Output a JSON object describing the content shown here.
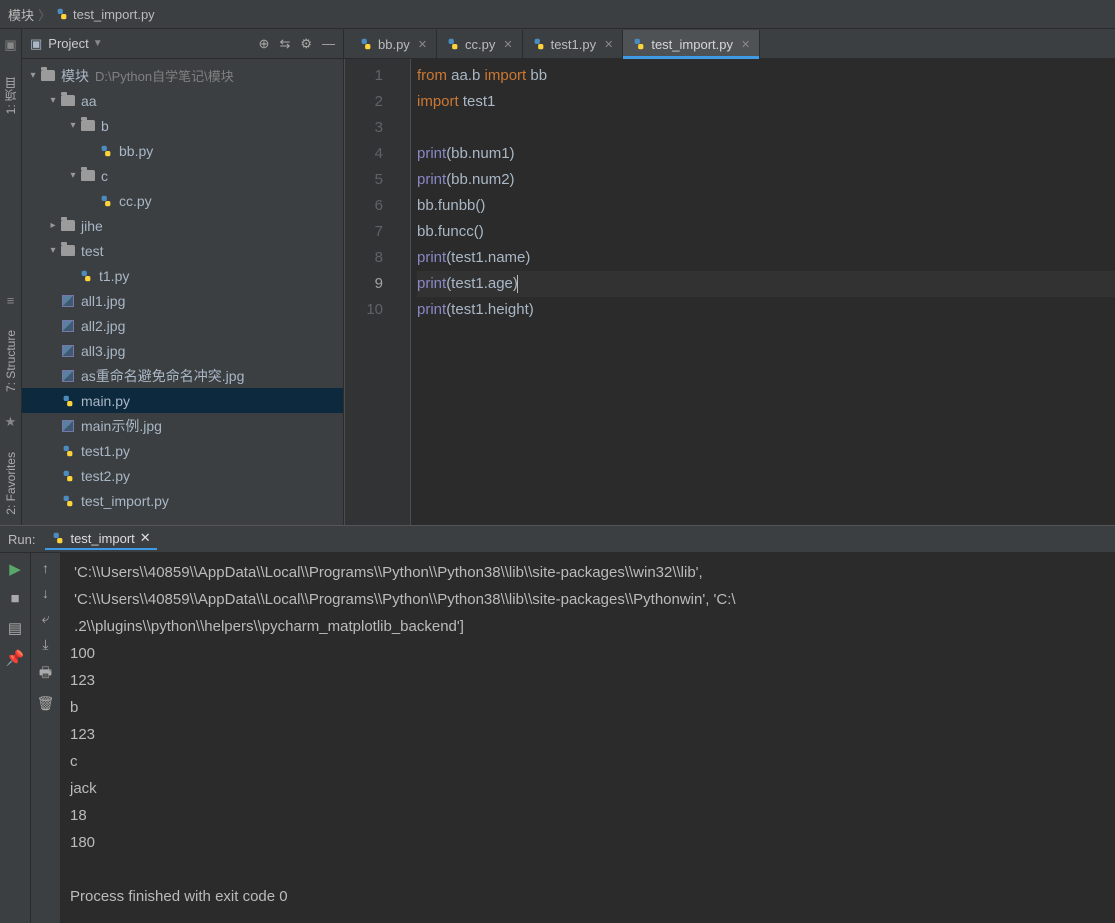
{
  "breadcrumb": {
    "root": "模块",
    "file": "test_import.py"
  },
  "rail": {
    "project_label": "1: 项目",
    "structure": "7: Structure",
    "favorites": "2: Favorites"
  },
  "project_header": {
    "title": "Project"
  },
  "tree": {
    "root_name": "模块",
    "root_path": "D:\\Python自学笔记\\模块",
    "aa": "aa",
    "b": "b",
    "bbpy": "bb.py",
    "c": "c",
    "ccpy": "cc.py",
    "jihe": "jihe",
    "test": "test",
    "t1py": "t1.py",
    "all1": "all1.jpg",
    "all2": "all2.jpg",
    "all3": "all3.jpg",
    "asjpg": "as重命名避免命名冲突.jpg",
    "mainpy": "main.py",
    "mainjpg": "main示例.jpg",
    "test1py": "test1.py",
    "test2py": "test2.py",
    "testimport": "test_import.py"
  },
  "tabs": [
    {
      "label": "bb.py"
    },
    {
      "label": "cc.py"
    },
    {
      "label": "test1.py"
    },
    {
      "label": "test_import.py"
    }
  ],
  "code": {
    "line_count": 10,
    "l1": {
      "a": "from ",
      "b": "aa.b ",
      "c": "import ",
      "d": "bb"
    },
    "l2": {
      "a": "import ",
      "b": "test1"
    },
    "l4": {
      "a": "print",
      "b": "(bb.num1)"
    },
    "l5": {
      "a": "print",
      "b": "(bb.num2)"
    },
    "l6": "bb.funbb()",
    "l7": "bb.funcc()",
    "l8": {
      "a": "print",
      "b": "(test1.name)"
    },
    "l9": {
      "a": "print",
      "b": "(test1.age)"
    },
    "l10": {
      "a": "print",
      "b": "(test1.height)"
    }
  },
  "run": {
    "label": "Run:",
    "tab": "test_import",
    "lines": {
      "l1": " 'C:\\\\Users\\\\40859\\\\AppData\\\\Local\\\\Programs\\\\Python\\\\Python38\\\\lib\\\\site-packages\\\\win32\\\\lib',",
      "l2": " 'C:\\\\Users\\\\40859\\\\AppData\\\\Local\\\\Programs\\\\Python\\\\Python38\\\\lib\\\\site-packages\\\\Pythonwin', 'C:\\",
      "l3": " .2\\\\plugins\\\\python\\\\helpers\\\\pycharm_matplotlib_backend']",
      "l4": "100",
      "l5": "123",
      "l6": "b",
      "l7": "123",
      "l8": "c",
      "l9": "jack",
      "l10": "18",
      "l11": "180",
      "l12": "",
      "l13": "Process finished with exit code 0"
    }
  }
}
